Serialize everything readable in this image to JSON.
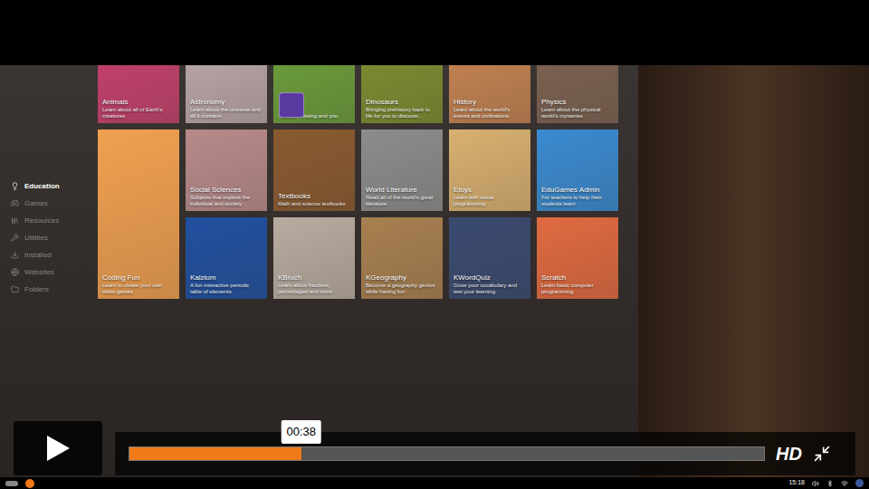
{
  "sidebar": {
    "items": [
      {
        "label": "Education",
        "selected": true
      },
      {
        "label": "Games",
        "selected": false
      },
      {
        "label": "Resources",
        "selected": false
      },
      {
        "label": "Utilities",
        "selected": false
      },
      {
        "label": "Installed",
        "selected": false
      },
      {
        "label": "Websites",
        "selected": false
      },
      {
        "label": "Folders",
        "selected": false
      }
    ]
  },
  "tiles": [
    {
      "title": "Animals",
      "description": "Learn about all of Earth's creatures",
      "color": "#c0406a",
      "kind": "normal"
    },
    {
      "title": "Astronomy",
      "description": "Learn about the universe and all it contains",
      "color": "#b6a3a3",
      "kind": "normal"
    },
    {
      "title": "",
      "description": "...about ... being and you",
      "color": "#6a9a3a",
      "kind": "normal"
    },
    {
      "title": "Dinosaurs",
      "description": "Bringing prehistory back to life for you to discover...",
      "color": "#7a8a30",
      "kind": "normal"
    },
    {
      "title": "History",
      "description": "Learn about the world's events and civilizations",
      "color": "#c08050",
      "kind": "normal"
    },
    {
      "title": "Physics",
      "description": "Learn about the physical world's mysteries",
      "color": "#7a6050",
      "kind": "normal"
    },
    {
      "title": "Coding Fun",
      "description": "Learn to create your own video games",
      "color": "#f0a050",
      "kind": "tall"
    },
    {
      "title": "Social Sciences",
      "description": "Subjects that explore the individual and society",
      "color": "#b88a8a",
      "kind": "normal"
    },
    {
      "title": "Textbooks",
      "description": "Math and science textbooks",
      "color": "#8a5a30",
      "kind": "normal"
    },
    {
      "title": "World Literature",
      "description": "Read all of the world's great literature",
      "color": "#8c8c8c",
      "kind": "normal"
    },
    {
      "title": "Etoys",
      "description": "Learn with visual programming",
      "color": "#d8b070",
      "kind": "normal"
    },
    {
      "title": "EduGames Admin",
      "description": "For teachers to help their students learn",
      "color": "#3a8ad0",
      "kind": "normal"
    },
    {
      "title": "Kalzium",
      "description": "A fun interactive periodic table of elements",
      "color": "#2050a0",
      "kind": "normal"
    },
    {
      "title": "KBruch",
      "description": "Learn about fractions, percentages and more",
      "color": "#b8aca0",
      "kind": "normal"
    },
    {
      "title": "KGeography",
      "description": "Become a geography genius while having fun",
      "color": "#a88050",
      "kind": "normal"
    },
    {
      "title": "KWordQuiz",
      "description": "Grow your vocabulary and test your learning",
      "color": "#3a4a70",
      "kind": "normal"
    },
    {
      "title": "Scratch",
      "description": "Learn basic computer programming",
      "color": "#e06a40",
      "kind": "normal"
    }
  ],
  "player": {
    "time": "00:38",
    "level": 0.27,
    "quality": "HD"
  },
  "taskbar": {
    "clock": "15:18"
  }
}
